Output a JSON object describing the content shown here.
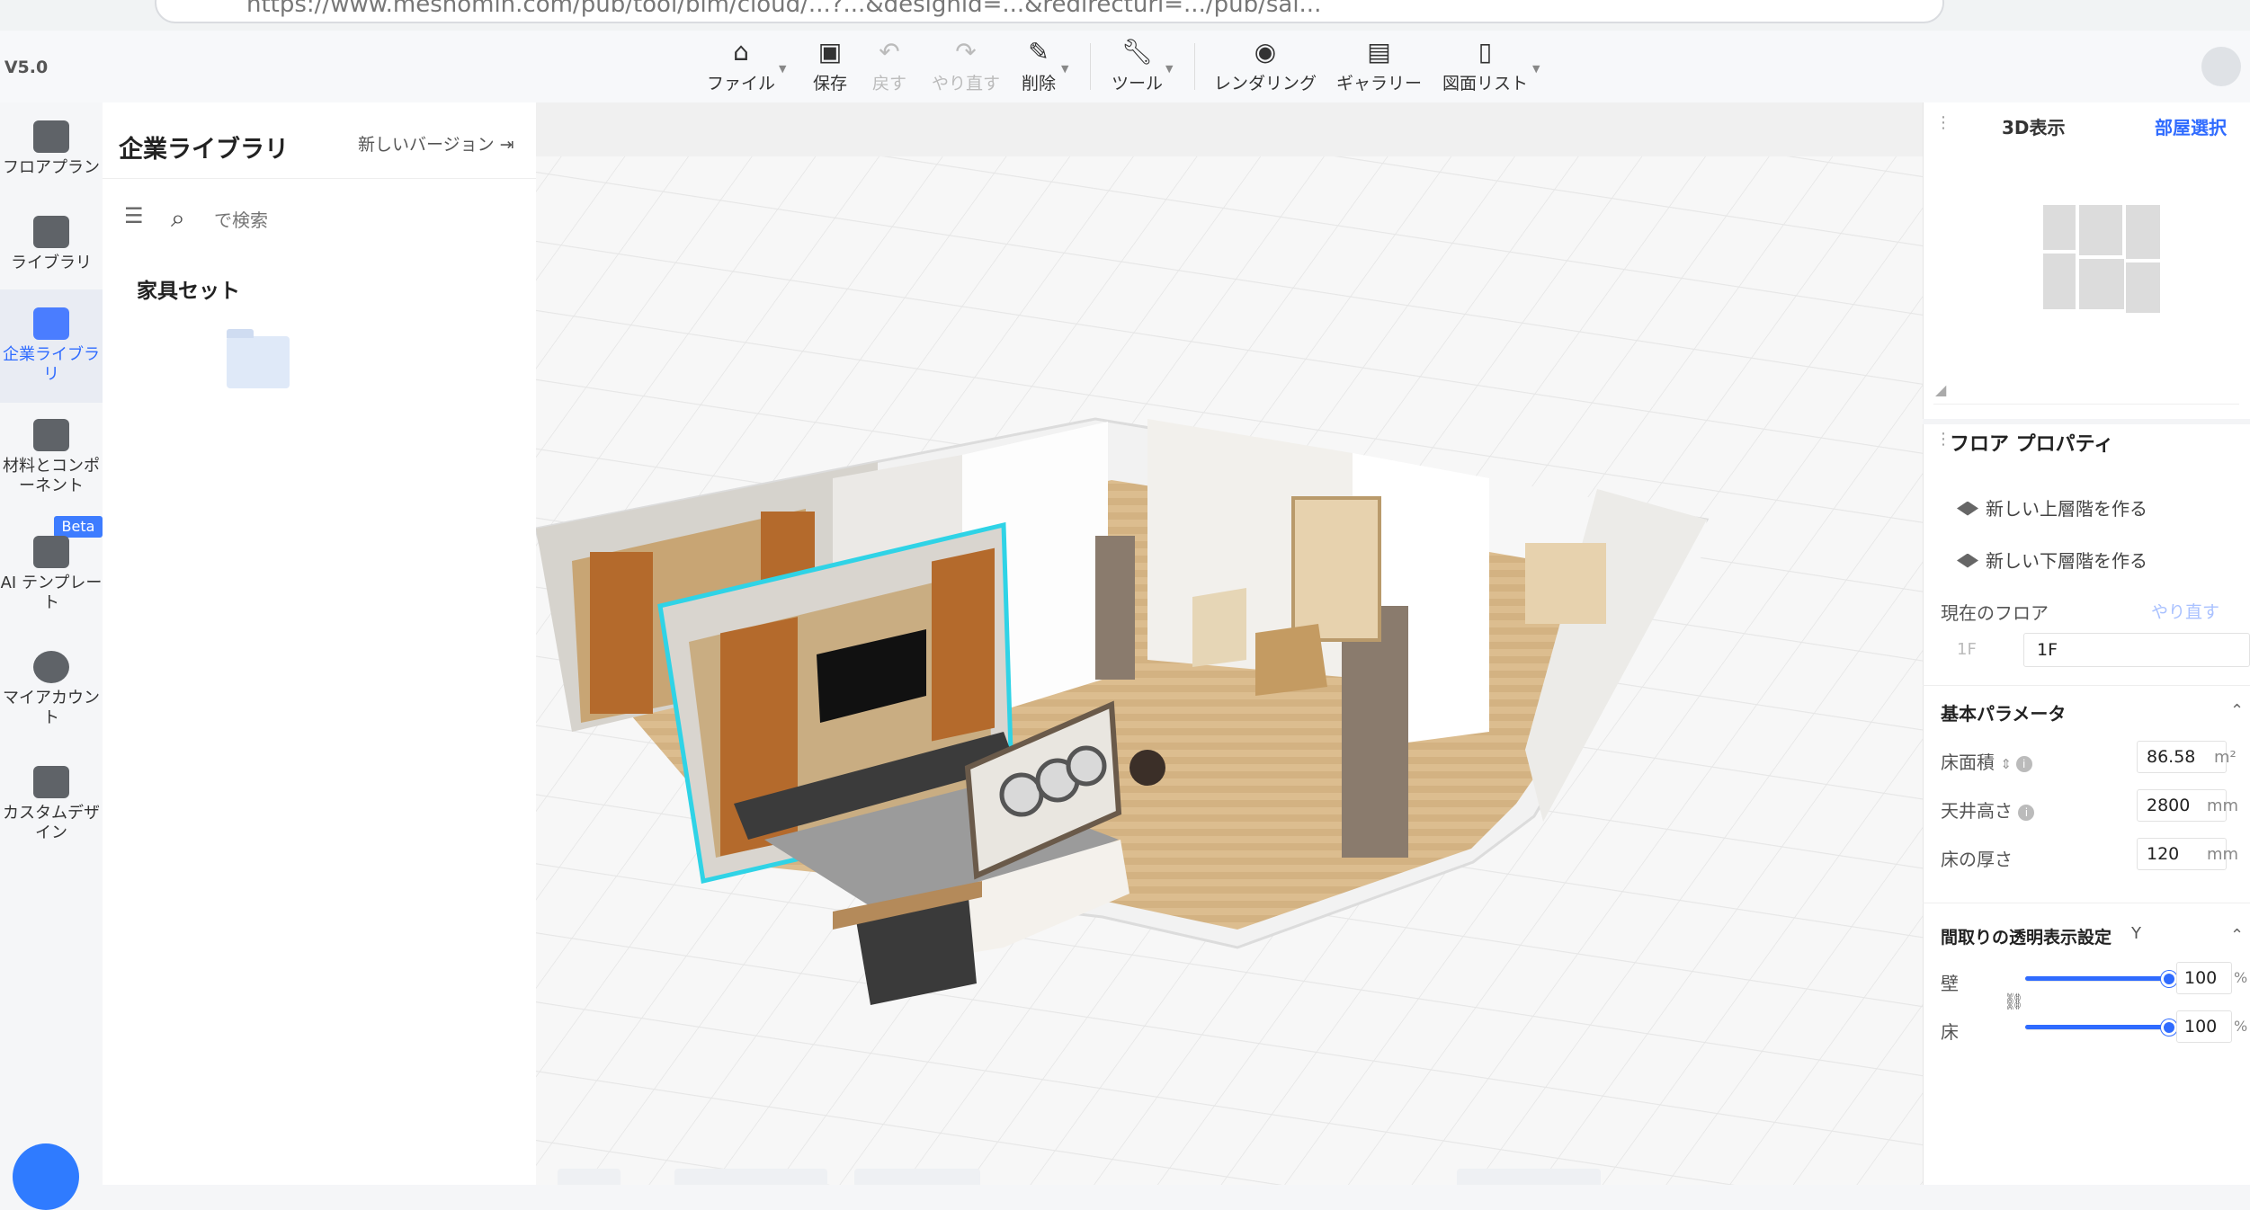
{
  "browser": {
    "url": "https://www.meshomin.com/pub/tool/bim/cloud/...?...&designid=...&redirecturl=.../pub/sai..."
  },
  "app": {
    "version": "V5.0"
  },
  "toolbar": {
    "items": [
      {
        "label": "ファイル",
        "icon": "home-icon",
        "disabled": false
      },
      {
        "label": "保存",
        "icon": "save-icon",
        "disabled": false
      },
      {
        "label": "戻す",
        "icon": "undo-icon",
        "disabled": true
      },
      {
        "label": "やり直す",
        "icon": "redo-icon",
        "disabled": true
      },
      {
        "label": "削除",
        "icon": "eraser-icon",
        "disabled": false
      },
      {
        "label": "ツール",
        "icon": "wrench-icon",
        "disabled": false
      },
      {
        "label": "レンダリング",
        "icon": "camera-icon",
        "disabled": false
      },
      {
        "label": "ギャラリー",
        "icon": "image-icon",
        "disabled": false
      },
      {
        "label": "図面リスト",
        "icon": "document-icon",
        "disabled": false
      }
    ]
  },
  "rail": {
    "items": [
      {
        "label": "フロアプラン",
        "icon": "floorplan-icon"
      },
      {
        "label": "ライブラリ",
        "icon": "sofa-icon"
      },
      {
        "label": "企業ライブラ\nリ",
        "icon": "crown-icon",
        "active": true
      },
      {
        "label": "材料とコンポ\nーネント",
        "icon": "material-icon"
      },
      {
        "label": "AI テンプレー\nト",
        "icon": "ai-template-icon"
      },
      {
        "label": "マイアカウン\nト",
        "icon": "user-icon"
      },
      {
        "label": "カスタムデザ\nイン",
        "icon": "custom-design-icon"
      }
    ],
    "beta_badge": "Beta"
  },
  "library": {
    "title": "企業ライブラリ",
    "new_version": "新しいバージョン",
    "search_placeholder": "で検索",
    "section": "家具セット"
  },
  "right_panel": {
    "tab_3d": "3D表示",
    "tab_room": "部屋選択",
    "floor_props_title": "フロア プロパティ",
    "new_upper": "新しい上層階を作る",
    "new_lower": "新しい下層階を作る",
    "current_floor_label": "現在のフロア",
    "redo_link": "やり直す",
    "floor_disabled": "1F",
    "floor_value": "1F",
    "basic_params": "基本パラメータ",
    "floor_area_label": "床面積",
    "floor_area_value": "86.58",
    "floor_area_unit": "m²",
    "ceiling_label": "天井高さ",
    "ceiling_value": "2800",
    "ceiling_unit": "mm",
    "thickness_label": "床の厚さ",
    "thickness_value": "120",
    "thickness_unit": "mm",
    "transparency_title": "間取りの透明表示設定",
    "transparency_hotkey": "Y",
    "wall_label": "壁",
    "wall_value": "100",
    "floor_label": "床",
    "floor_trans_value": "100",
    "percent": "%",
    "wall_fraction": 1.0,
    "floor_fraction": 1.0
  },
  "colors": {
    "accent": "#2f6bff",
    "selection": "#2fd3e6",
    "wood": "#d9b98a"
  }
}
